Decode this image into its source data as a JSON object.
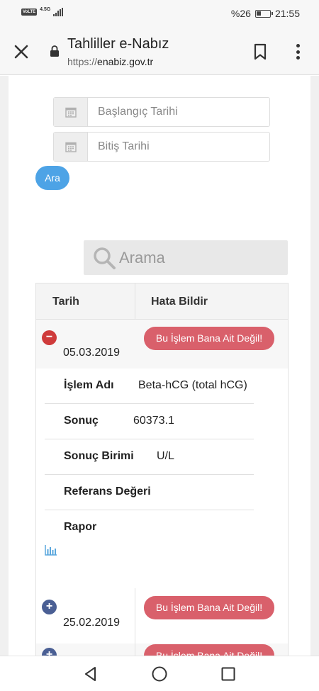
{
  "status_bar": {
    "left_tags": [
      "VoLTE",
      "4.5G"
    ],
    "battery": "%26",
    "time": "21:55"
  },
  "browser": {
    "title": "Tahliller e-Nabız",
    "url_scheme": "https://",
    "url_host": "enabiz.gov.tr"
  },
  "filters": {
    "start_placeholder": "Başlangıç Tarihi",
    "end_placeholder": "Bitiş Tarihi",
    "search_button": "Ara"
  },
  "search": {
    "placeholder": "Arama"
  },
  "table": {
    "headers": [
      "Tarih",
      "Hata Bildir"
    ],
    "rows": [
      {
        "date": "05.03.2019",
        "expanded": true,
        "report_label": "Bu İşlem Bana Ait Değil!",
        "details": [
          {
            "label": "İşlem Adı",
            "value": "Beta-hCG (total hCG)"
          },
          {
            "label": "Sonuç",
            "value": "60373.1"
          },
          {
            "label": "Sonuç Birimi",
            "value": "U/L"
          },
          {
            "label": "Referans Değeri",
            "value": ""
          },
          {
            "label": "Rapor",
            "value": ""
          }
        ]
      },
      {
        "date": "25.02.2019",
        "expanded": false,
        "report_label": "Bu İşlem Bana Ait Değil!"
      },
      {
        "date": "",
        "expanded": false,
        "report_label": "Bu İşlem Bana Ait Değil!"
      }
    ]
  },
  "colors": {
    "accent_blue": "#4da3e6",
    "report_red": "#d9606b",
    "collapse_red": "#cf3b3b",
    "expand_navy": "#4a5f94"
  },
  "icons": {
    "close": "close-icon",
    "lock": "lock-icon",
    "bookmark": "bookmark-icon",
    "menu": "more-vertical-icon",
    "calendar": "calendar-icon",
    "search": "search-icon",
    "chart": "bar-chart-icon",
    "nav_back": "back-triangle-icon",
    "nav_home": "home-circle-icon",
    "nav_recent": "recents-square-icon"
  }
}
